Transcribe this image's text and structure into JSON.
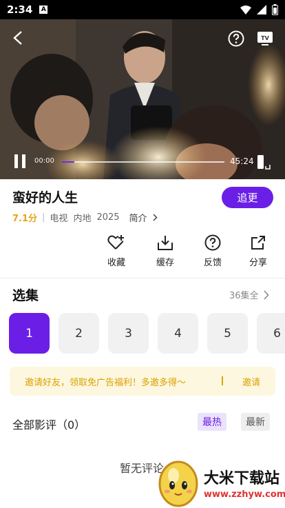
{
  "status_bar": {
    "time": "2:34",
    "badge": "A"
  },
  "player": {
    "time_current": "00:00",
    "time_total": "45:24",
    "progress": 0.02,
    "icons": [
      "back-arrow-icon",
      "help-circle-icon",
      "tv-cast-icon",
      "pause-icon",
      "fullscreen-icon"
    ]
  },
  "show": {
    "title": "蛮好的人生",
    "score": "7.1分",
    "type": "电视",
    "region": "内地",
    "year": "2025",
    "intro": "简介",
    "follow_label": "追更"
  },
  "actions": [
    {
      "label": "收藏",
      "icon": "heart-plus-icon"
    },
    {
      "label": "缓存",
      "icon": "download-icon"
    },
    {
      "label": "反馈",
      "icon": "feedback-question-icon"
    },
    {
      "label": "分享",
      "icon": "share-icon"
    }
  ],
  "episodes": {
    "title": "选集",
    "all_label": "36集全",
    "items": [
      "1",
      "2",
      "3",
      "4",
      "5",
      "6"
    ],
    "selected": "1"
  },
  "invite": {
    "text": "邀请好友，领取免广告福利！多邀多得～",
    "action": "邀请"
  },
  "reviews": {
    "title": "全部影评（0）",
    "sort_hot": "最热",
    "sort_new": "最新",
    "empty_text": "暂无评论"
  },
  "watermark": {
    "name": "大米下载站",
    "url": "www.zzhyw.com"
  },
  "colors": {
    "accent": "#6b1fe6",
    "score": "#e8a31a",
    "invite": "#d9a200"
  }
}
